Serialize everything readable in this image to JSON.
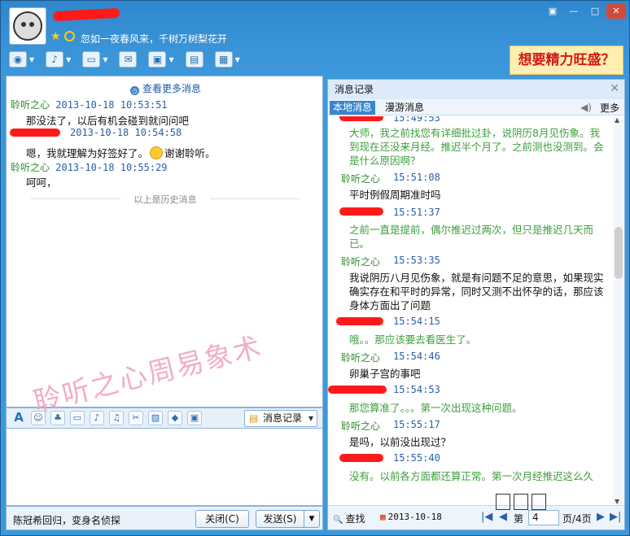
{
  "header": {
    "signature": "忽如一夜春风来，千树万树梨花开",
    "ad_text": "想要精力旺盛？",
    "window_buttons": [
      "▣",
      "—",
      "□",
      "✕"
    ]
  },
  "toolbar": {
    "icons": [
      "video-call-icon",
      "voice-call-icon",
      "file-transfer-icon",
      "sms-icon",
      "remote-assist-icon",
      "app-share-icon",
      "apps-grid-icon"
    ]
  },
  "left_chat": {
    "more_messages": "查看更多消息",
    "messages": [
      {
        "name": "聆听之心",
        "time": "2013-10-18 10:53:51",
        "text": "那没法了，以后有机会碰到就问问吧"
      },
      {
        "name": "",
        "time": "2013-10-18 10:54:58",
        "text_before": "嗯，我就理解为好签好了。",
        "text_after": "谢谢聆听。"
      },
      {
        "name": "聆听之心",
        "time": "2013-10-18 10:55:29",
        "text": "呵呵，"
      }
    ],
    "history_divider": "以上是历史消息"
  },
  "format_bar": {
    "history_button": "消息记录"
  },
  "watermark": "聆听之心周易象术",
  "bottom_bar": {
    "ticker": "陈冠希回归，变身名侦探",
    "close_button": "关闭(C)",
    "send_button": "发送(S)"
  },
  "history_panel": {
    "title": "消息记录",
    "tab_local": "本地消息",
    "tab_roam": "漫游消息",
    "more": "更多",
    "entries": [
      {
        "kind": "time",
        "time": "15:49:53"
      },
      {
        "kind": "green",
        "text": "大师，我之前找您有详细批过卦，说阴历8月见伤象。我到现在还没来月经。推迟半个月了。之前测也没测到。会是什么原因啊？"
      },
      {
        "kind": "name",
        "name": "聆听之心",
        "time": "15:51:08"
      },
      {
        "kind": "black",
        "text": "平时例假周期准时吗"
      },
      {
        "kind": "time",
        "time": "15:51:37"
      },
      {
        "kind": "green",
        "text": "之前一直是提前，偶尔推迟过两次，但只是推迟几天而已。"
      },
      {
        "kind": "name",
        "name": "聆听之心",
        "time": "15:53:35"
      },
      {
        "kind": "black",
        "text": "我说阴历八月见伤象，就是有问题不足的意思，如果现实确实存在和平时的异常，同时又测不出怀孕的话，那应该身体方面出了问题"
      },
      {
        "kind": "time",
        "time": "15:54:15"
      },
      {
        "kind": "green",
        "text": "哦。。那应该要去看医生了。"
      },
      {
        "kind": "name",
        "name": "聆听之心",
        "time": "15:54:46"
      },
      {
        "kind": "black",
        "text": "卵巢子宫的事吧"
      },
      {
        "kind": "time",
        "time": "15:54:53"
      },
      {
        "kind": "green",
        "text": "那您算准了。。。第一次出现这种问题。"
      },
      {
        "kind": "name",
        "name": "聆听之心",
        "time": "15:55:17"
      },
      {
        "kind": "black",
        "text": "是吗，以前没出现过？"
      },
      {
        "kind": "time",
        "time": "15:55:40"
      },
      {
        "kind": "green",
        "text": "没有。以前各方面都还算正常。第一次月经推迟这么久"
      }
    ],
    "footer": {
      "find": "查找",
      "date": "2013-10-18",
      "page_label": "第",
      "page_value": "4",
      "page_total": "页/4页"
    }
  }
}
